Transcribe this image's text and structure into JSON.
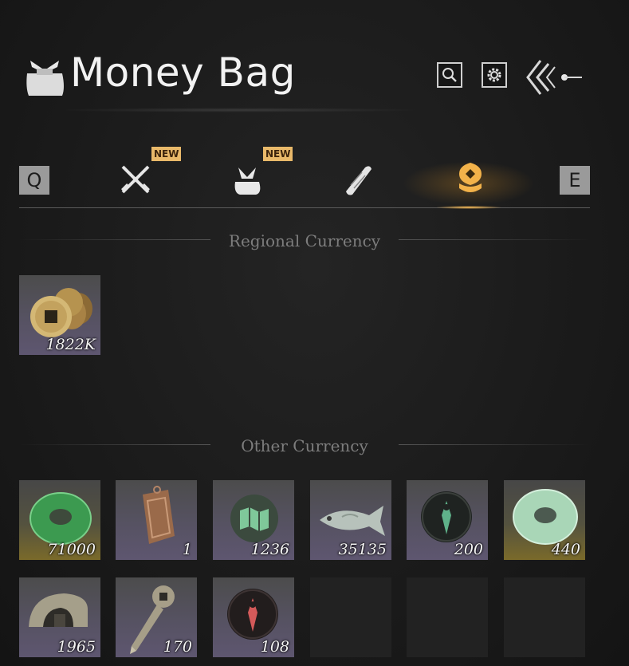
{
  "header": {
    "title": "Money Bag",
    "icons": [
      "money-bag-icon",
      "search-icon",
      "gear-icon",
      "back-arrow-icon"
    ]
  },
  "tabs": {
    "left_key": "Q",
    "right_key": "E",
    "items": [
      {
        "name": "weapons",
        "icon": "crossed-swords-icon",
        "badge": "NEW",
        "active": false
      },
      {
        "name": "bag",
        "icon": "bundle-icon",
        "badge": "NEW",
        "active": false
      },
      {
        "name": "scrolls",
        "icon": "scroll-icon",
        "badge": "",
        "active": false
      },
      {
        "name": "currency",
        "icon": "coin-stack-icon",
        "badge": "",
        "active": true
      }
    ],
    "active_color": "#f2b24a"
  },
  "sections": {
    "regional": {
      "label": "Regional Currency",
      "items": [
        {
          "icon": "copper-coins-icon",
          "quantity": "1822K"
        }
      ]
    },
    "other": {
      "label": "Other Currency",
      "items": [
        {
          "icon": "green-jade-ring-icon",
          "quantity": "71000",
          "rarity": "gold"
        },
        {
          "icon": "bronze-token-icon",
          "quantity": "1",
          "rarity": "purple"
        },
        {
          "icon": "map-scroll-icon",
          "quantity": "1236",
          "rarity": "purple"
        },
        {
          "icon": "jade-fish-icon",
          "quantity": "35135",
          "rarity": "purple"
        },
        {
          "icon": "green-glyph-emblem-icon",
          "quantity": "200",
          "rarity": "purple"
        },
        {
          "icon": "pale-jade-ring-icon",
          "quantity": "440",
          "rarity": "gold"
        },
        {
          "icon": "half-coin-icon",
          "quantity": "1965",
          "rarity": "purple"
        },
        {
          "icon": "coin-sword-icon",
          "quantity": "170",
          "rarity": "purple"
        },
        {
          "icon": "red-glyph-emblem-icon",
          "quantity": "108",
          "rarity": "purple"
        }
      ]
    }
  }
}
